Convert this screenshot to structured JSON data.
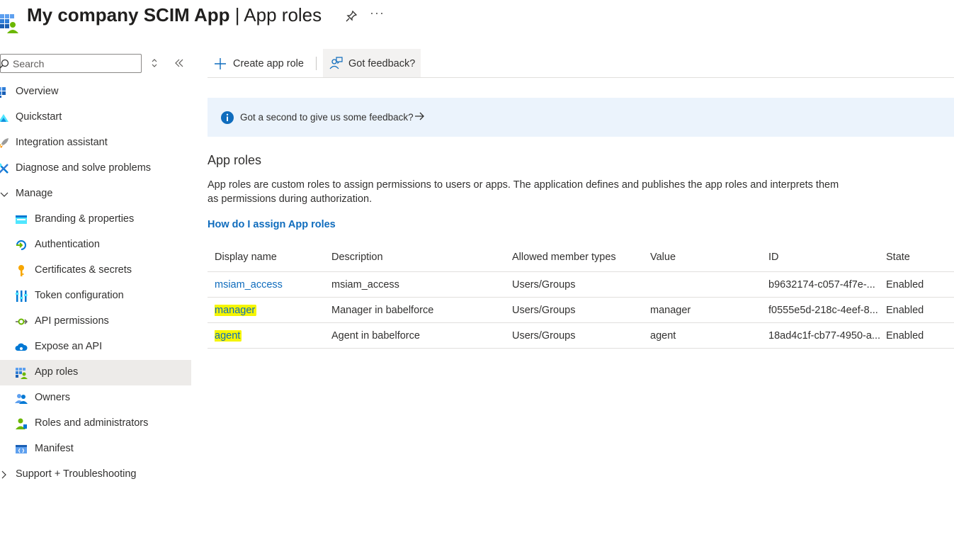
{
  "header": {
    "app_name": "My company SCIM App",
    "separator": " | ",
    "page": "App roles",
    "more": "···"
  },
  "sidebar": {
    "search": {
      "placeholder": "Search",
      "value": ""
    },
    "items": [
      {
        "label": "Overview",
        "icon": "overview-icon",
        "level": 0
      },
      {
        "label": "Quickstart",
        "icon": "quickstart-icon",
        "level": 0
      },
      {
        "label": "Integration assistant",
        "icon": "rocket-icon",
        "level": 0
      },
      {
        "label": "Diagnose and solve problems",
        "icon": "wrench-icon",
        "level": 0
      },
      {
        "label": "Manage",
        "icon": "chevron-down-icon",
        "level": 0,
        "expanded": true
      },
      {
        "label": "Branding & properties",
        "icon": "branding-icon",
        "level": 1
      },
      {
        "label": "Authentication",
        "icon": "authentication-icon",
        "level": 1
      },
      {
        "label": "Certificates & secrets",
        "icon": "key-icon",
        "level": 1
      },
      {
        "label": "Token configuration",
        "icon": "token-icon",
        "level": 1
      },
      {
        "label": "API permissions",
        "icon": "api-permissions-icon",
        "level": 1
      },
      {
        "label": "Expose an API",
        "icon": "cloud-icon",
        "level": 1
      },
      {
        "label": "App roles",
        "icon": "app-roles-icon",
        "level": 1,
        "selected": true
      },
      {
        "label": "Owners",
        "icon": "owners-icon",
        "level": 1
      },
      {
        "label": "Roles and administrators",
        "icon": "roles-admin-icon",
        "level": 1
      },
      {
        "label": "Manifest",
        "icon": "manifest-icon",
        "level": 1
      },
      {
        "label": "Support + Troubleshooting",
        "icon": "chevron-right-icon",
        "level": 0,
        "expanded": false
      }
    ]
  },
  "toolbar": {
    "create_label": "Create app role",
    "feedback_label": "Got feedback?"
  },
  "banner": {
    "message": "Got a second to give us some feedback?"
  },
  "content": {
    "title": "App roles",
    "description": "App roles are custom roles to assign permissions to users or apps. The application defines and publishes the app roles and interprets them as permissions during authorization.",
    "help_link": "How do I assign App roles"
  },
  "table": {
    "columns": [
      "Display name",
      "Description",
      "Allowed member types",
      "Value",
      "ID",
      "State"
    ],
    "rows": [
      {
        "display_name": "msiam_access",
        "description": "msiam_access",
        "member_types": "Users/Groups",
        "value": "",
        "id": "b9632174-c057-4f7e-...",
        "state": "Enabled",
        "highlighted": false
      },
      {
        "display_name": "manager",
        "description": "Manager in babelforce",
        "member_types": "Users/Groups",
        "value": "manager",
        "id": "f0555e5d-218c-4eef-8...",
        "state": "Enabled",
        "highlighted": true
      },
      {
        "display_name": "agent",
        "description": "Agent in babelforce",
        "member_types": "Users/Groups",
        "value": "agent",
        "id": "18ad4c1f-cb77-4950-a...",
        "state": "Enabled",
        "highlighted": true
      }
    ]
  },
  "colors": {
    "accent": "#0f6cbd",
    "highlight": "#f5f500",
    "banner_bg": "#ebf3fc",
    "selected_bg": "#edebe9"
  }
}
